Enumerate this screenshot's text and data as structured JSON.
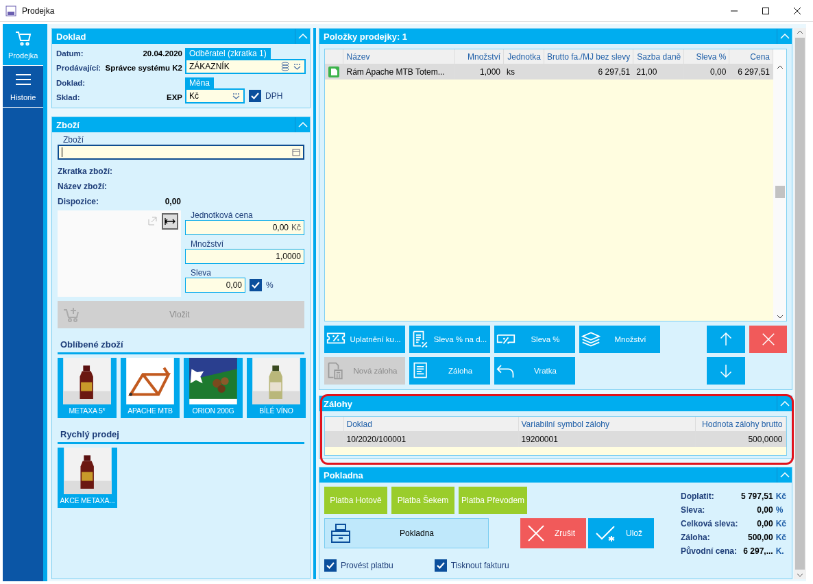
{
  "window": {
    "title": "Prodejka"
  },
  "nav": [
    {
      "label": "Prodejka",
      "selected": true
    },
    {
      "label": "Historie",
      "selected": false
    }
  ],
  "doklad_panel": {
    "title": "Doklad",
    "fields": [
      {
        "label": "Datum:",
        "value": "20.04.2020"
      },
      {
        "label": "Prodávající:",
        "value": "Správce systému K2"
      },
      {
        "label": "Doklad:"
      },
      {
        "label": "Sklad:",
        "value": "EXP"
      }
    ],
    "customer": {
      "label": "Odběratel (zkratka 1)",
      "value": "ZÁKAZNÍK"
    },
    "currency": {
      "label": "Měna",
      "value": "Kč"
    },
    "vat": {
      "label": "DPH",
      "checked": true
    }
  },
  "goods_panel": {
    "title": "Zboží",
    "search": {
      "label": "Zboží"
    },
    "info": [
      {
        "label": "Zkratka zboží:"
      },
      {
        "label": "Název zboží:"
      },
      {
        "label": "Dispozice:",
        "value": "0,00"
      }
    ],
    "unit_price": {
      "label": "Jednotková cena",
      "value": "0,00",
      "unit": "Kč"
    },
    "quantity": {
      "label": "Množství",
      "value": "1,0000"
    },
    "discount": {
      "label": "Sleva",
      "value": "0,00",
      "percent": {
        "label": "%",
        "checked": true
      }
    },
    "insert_button": {
      "label": "Vložit",
      "disabled": true
    },
    "favorites": {
      "title": "Oblíbené zboží",
      "items": [
        {
          "label": "METAXA 5*",
          "kind": "picture"
        },
        {
          "label": "APACHE MTB",
          "kind": "picture"
        },
        {
          "label": "ORION 200G",
          "kind": "picture"
        },
        {
          "label": "BÍLÉ VÍNO",
          "kind": "picture"
        }
      ]
    },
    "quick_sale": {
      "title": "Rychlý prodej",
      "items": [
        {
          "label": "AKCE METAXA...",
          "kind": "picture"
        }
      ]
    }
  },
  "items_panel": {
    "title": "Položky prodejky: 1",
    "table": {
      "columns": [
        "Název",
        "Množství",
        "Jednotka",
        "Brutto fa./MJ bez slevy",
        "Sazba daně",
        "Sleva %",
        "Cena"
      ],
      "rows": [
        {
          "selected": true,
          "cells": [
            "Rám Apache MTB Totem...",
            "1,000",
            "ks",
            "6 297,51",
            "21,00",
            "0,00",
            "6 297,51"
          ]
        }
      ]
    },
    "actions": [
      {
        "label": "Uplatnění ku...",
        "disabled": false
      },
      {
        "label": "Sleva % na d...",
        "disabled": false
      },
      {
        "label": "Sleva %",
        "disabled": false
      },
      {
        "label": "Množství",
        "disabled": false
      },
      {
        "label": "Nová záloha",
        "disabled": true
      },
      {
        "label": "Záloha",
        "disabled": false
      },
      {
        "label": "Vratka",
        "disabled": false
      }
    ]
  },
  "advances_panel": {
    "title": "Zálohy",
    "highlighted": true,
    "table": {
      "columns": [
        "Doklad",
        "Variabilní symbol zálohy",
        "Hodnota zálohy brutto"
      ],
      "rows": [
        {
          "selected": true,
          "cells": [
            "10/2020/100001",
            "19200001",
            "500,0000"
          ]
        }
      ]
    }
  },
  "cash_panel": {
    "title": "Pokladna",
    "payment_buttons": [
      "Platba Hotově",
      "Platba Šekem",
      "Platba Převodem"
    ],
    "register_button": {
      "label": "Pokladna"
    },
    "cancel_button": {
      "label": "Zrušit"
    },
    "save_button": {
      "label": "Ulož"
    },
    "options": [
      {
        "label": "Provést platbu",
        "checked": true
      },
      {
        "label": "Tisknout fakturu",
        "checked": true
      }
    ],
    "summary": [
      {
        "label": "Doplatit:",
        "value": "5 797,51",
        "unit": "Kč"
      },
      {
        "label": "Sleva:",
        "value": "0,00",
        "unit": "%"
      },
      {
        "label": "Celková sleva:",
        "value": "0,00",
        "unit": "Kč"
      },
      {
        "label": "Záloha:",
        "value": "500,00",
        "unit": "Kč"
      },
      {
        "label": "Původní cena:",
        "value": "6 297,...",
        "unit": "K."
      }
    ]
  }
}
